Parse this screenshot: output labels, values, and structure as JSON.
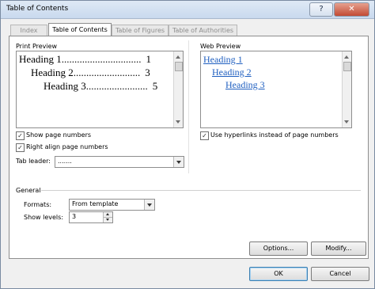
{
  "window": {
    "title": "Table of Contents",
    "help": "?",
    "close": "✕"
  },
  "tabs": [
    "Index",
    "Table of Contents",
    "Table of Figures",
    "Table of Authorities"
  ],
  "print_preview": {
    "label": "Print Preview",
    "lines": [
      {
        "text": "Heading 1",
        "leader": "...............................",
        "page": "1"
      },
      {
        "text": "Heading 2",
        "leader": "..........................",
        "page": "3"
      },
      {
        "text": "Heading 3",
        "leader": "........................",
        "page": "5"
      }
    ]
  },
  "web_preview": {
    "label": "Web Preview",
    "lines": [
      "Heading 1",
      "Heading 2",
      "Heading 3"
    ]
  },
  "options": {
    "show_page_numbers": {
      "label": "Show page numbers",
      "checked": true
    },
    "right_align": {
      "label": "Right align page numbers",
      "checked": true
    },
    "use_hyperlinks": {
      "label": "Use hyperlinks instead of page numbers",
      "checked": true
    },
    "tab_leader": {
      "label": "Tab leader:",
      "value": "......."
    }
  },
  "general": {
    "label": "General",
    "formats": {
      "label": "Formats:",
      "value": "From template"
    },
    "show_levels": {
      "label": "Show levels:",
      "value": "3"
    }
  },
  "buttons": {
    "options": "Options...",
    "modify": "Modify...",
    "ok": "OK",
    "cancel": "Cancel"
  },
  "colors": {
    "hyperlink": "#1f5fc0",
    "accent": "#3c7fb1"
  }
}
